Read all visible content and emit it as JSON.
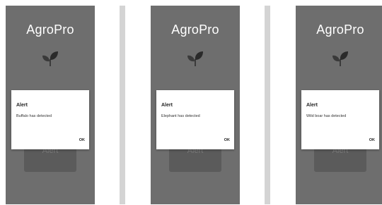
{
  "screens": [
    {
      "app_title": "AgroPro",
      "dialog": {
        "title": "Alert",
        "message": "Buffalo has detected",
        "ok_label": "OK"
      },
      "underlay_label": "Alert"
    },
    {
      "app_title": "AgroPro",
      "dialog": {
        "title": "Alert",
        "message": "Elephant has detected",
        "ok_label": "OK"
      },
      "underlay_label": "Alert"
    },
    {
      "app_title": "AgroPro",
      "dialog": {
        "title": "Alert",
        "message": "Wild boar has detected",
        "ok_label": "OK"
      },
      "underlay_label": "Alert"
    }
  ],
  "icons": {
    "logo": "leaf-icon"
  },
  "colors": {
    "screen_background": "#6e6e6e",
    "dialog_background": "#ffffff",
    "divider": "#d4d4d4"
  }
}
